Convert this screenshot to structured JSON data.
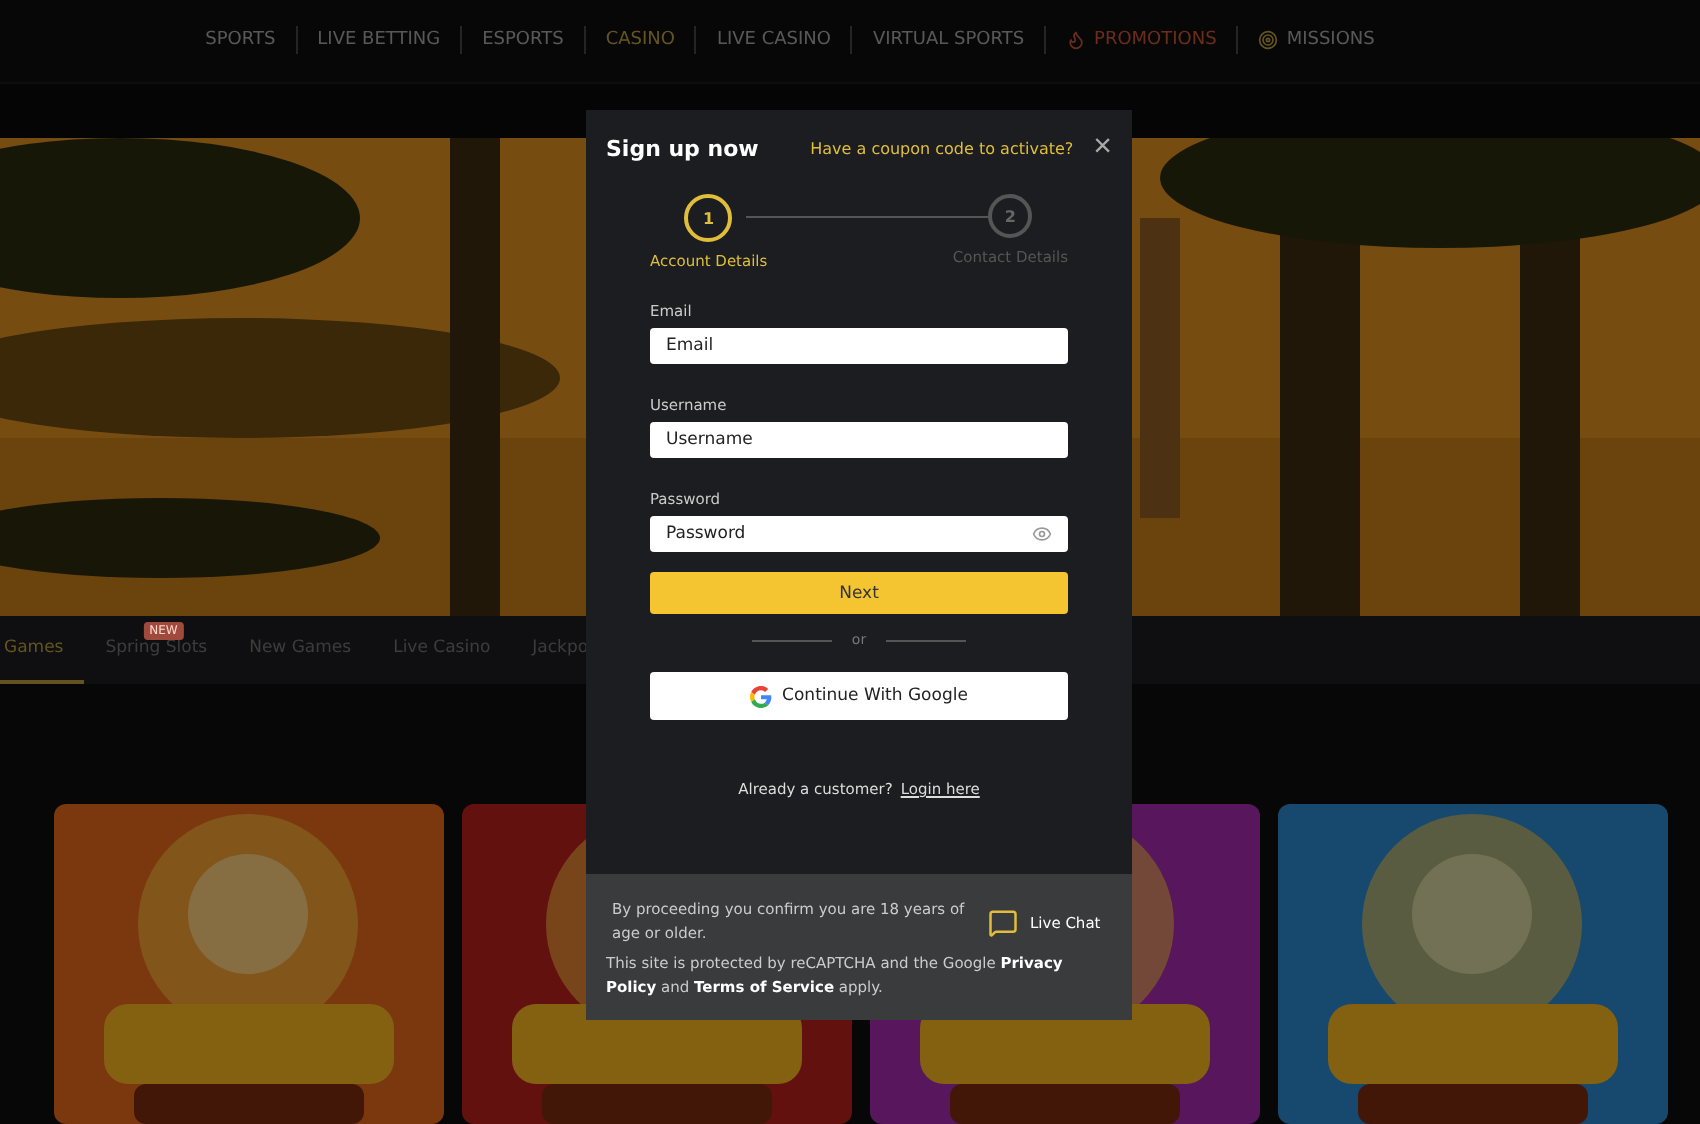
{
  "nav": [
    {
      "label": "SPORTS",
      "selected": false,
      "kind": "plain"
    },
    {
      "label": "LIVE BETTING",
      "selected": false,
      "kind": "plain"
    },
    {
      "label": "ESPORTS",
      "selected": false,
      "kind": "plain"
    },
    {
      "label": "CASINO",
      "selected": true,
      "kind": "plain"
    },
    {
      "label": "LIVE CASINO",
      "selected": false,
      "kind": "plain"
    },
    {
      "label": "VIRTUAL SPORTS",
      "selected": false,
      "kind": "plain"
    },
    {
      "label": "PROMOTIONS",
      "selected": false,
      "kind": "promo"
    },
    {
      "label": "MISSIONS",
      "selected": false,
      "kind": "missions"
    }
  ],
  "category_tabs": [
    {
      "label": "Games",
      "selected": true
    },
    {
      "label": "Spring Slots",
      "selected": false,
      "badge": "NEW"
    },
    {
      "label": "New Games",
      "selected": false
    },
    {
      "label": "Live Casino",
      "selected": false
    },
    {
      "label": "Jackpo",
      "selected": false
    }
  ],
  "modal": {
    "title": "Sign up now",
    "coupon_link": "Have a coupon code to activate?",
    "close": "×",
    "steps": [
      {
        "number": "1",
        "label": "Account Details",
        "selected": true
      },
      {
        "number": "2",
        "label": "Contact Details",
        "selected": false
      }
    ],
    "fields": [
      {
        "label": "Email",
        "placeholder": "Email",
        "kind": "text"
      },
      {
        "label": "Username",
        "placeholder": "Username",
        "kind": "text"
      },
      {
        "label": "Password",
        "placeholder": "Password",
        "kind": "password"
      }
    ],
    "next_button": "Next",
    "divider": "or",
    "google_button": "Continue With Google",
    "login_prompt": "Already a customer?",
    "login_link": "Login here",
    "age_notice": "By proceeding you confirm you are 18 years of age or older.",
    "live_chat": "Live Chat",
    "recaptcha": "This site is protected by reCAPTCHA and the Google **Privacy Policy** and **Terms of Service** apply."
  }
}
